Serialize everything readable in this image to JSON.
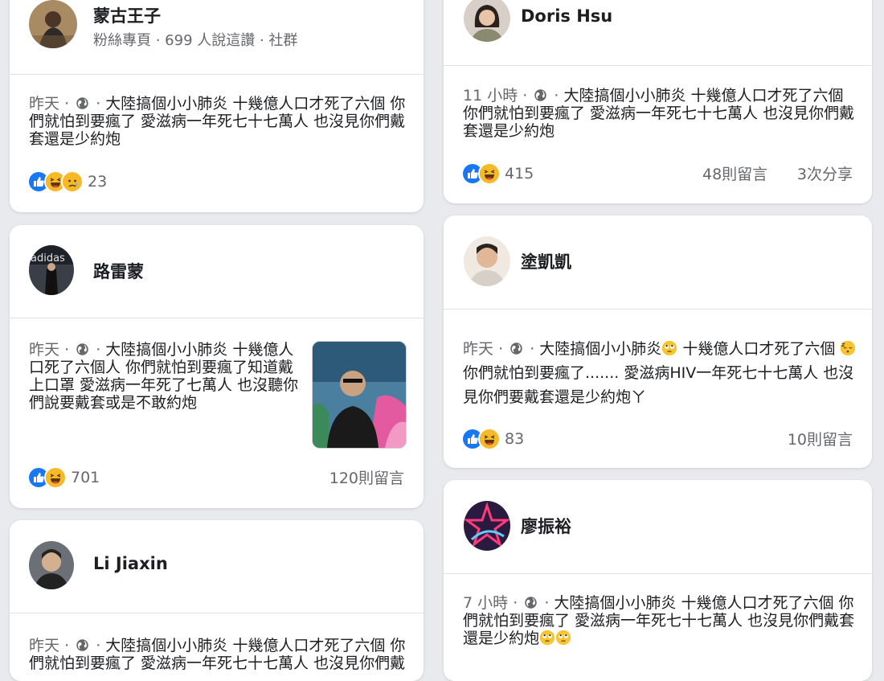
{
  "cards": {
    "c1": {
      "name": "蒙古王子",
      "subtitle": "粉絲專頁 · 699 人說這讚 · 社群",
      "time": "昨天",
      "text": "大陸搞個小小肺炎 十幾億人口才死了六個 你們就怕到要瘋了 愛滋病一年死七十七萬人 也沒見你們戴套還是少約炮",
      "reaction_count": "23"
    },
    "c2": {
      "name": "路雷蒙",
      "avatar_text": "adidas",
      "time": "昨天",
      "text": "大陸搞個小小肺炎 十幾億人口死了六個人 你們就怕到要瘋了知道戴上口罩 愛滋病一年死了七萬人 也沒聽你們說要戴套或是不敢約炮",
      "reaction_count": "701",
      "comments": "120則留言"
    },
    "c3": {
      "name": "Li Jiaxin",
      "time": "昨天",
      "text": "大陸搞個小小肺炎 十幾億人口才死了六個 你們就怕到要瘋了 愛滋病一年死七十七萬人 也沒見你們戴"
    },
    "c4": {
      "name": "Doris Hsu",
      "time": "11 小時",
      "text": "大陸搞個小小肺炎 十幾億人口才死了六個 你們就怕到要瘋了 愛滋病一年死七十七萬人 也沒見你們戴套還是少約炮",
      "reaction_count": "415",
      "comments": "48則留言",
      "shares": "3次分享"
    },
    "c5": {
      "name": "塗凱凱",
      "time": "昨天",
      "text_a": "大陸搞個小小肺炎",
      "text_b": "十幾億人口才死了六個",
      "text_c": "你們就怕到要瘋了....... 愛滋病HIV一年死七十七萬人 也沒見你們要戴套還是少約炮ㄚ",
      "reaction_count": "83",
      "comments": "10則留言"
    },
    "c6": {
      "name": "廖振裕",
      "time": "7 小時",
      "text": "大陸搞個小小肺炎 十幾億人口才死了六個 你們就怕到要瘋了 愛滋病一年死七十七萬人 也沒見你們戴套還是少約炮"
    }
  },
  "separator": "·",
  "icons": {
    "privacy": "globe-icon",
    "reactions": [
      "like-reaction-icon",
      "haha-reaction-icon",
      "sad-reaction-icon"
    ],
    "inline_emoji": [
      "eye-roll-emoji",
      "sleepy-emoji"
    ]
  },
  "colors": {
    "background": "#e9eaed",
    "card": "#ffffff",
    "like_blue": "#1877f2",
    "emoji_yellow": "#f7b928",
    "muted_text": "#65676b"
  }
}
